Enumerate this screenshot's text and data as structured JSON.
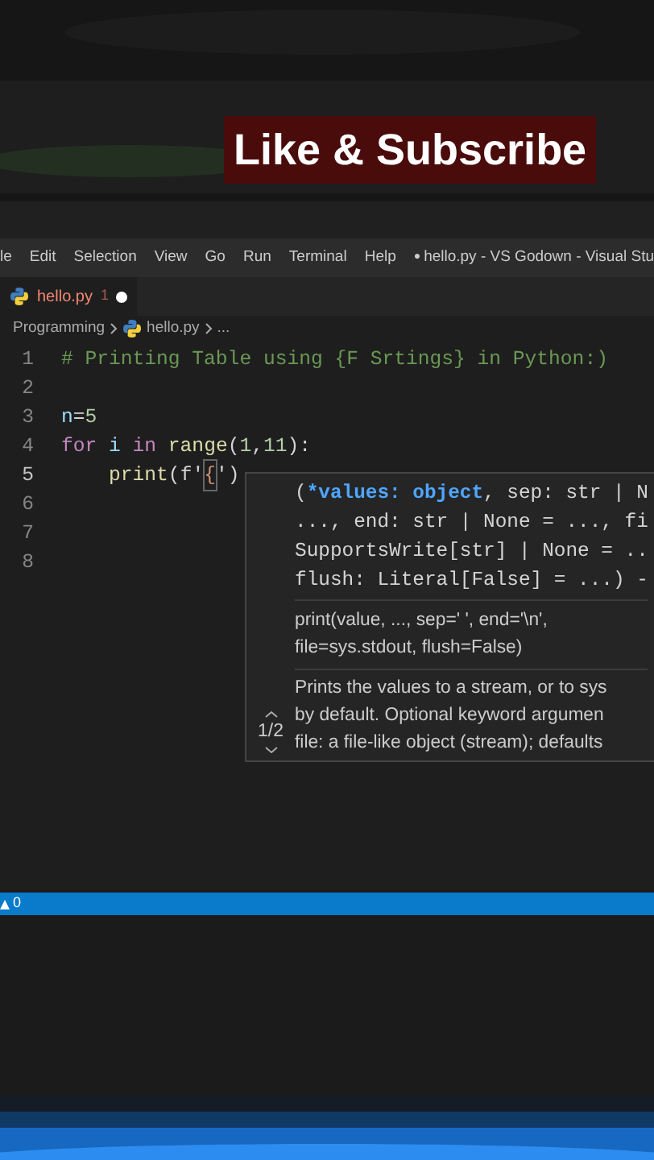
{
  "banner": {
    "text": "Like & Subscribe"
  },
  "menu_bar": {
    "items": [
      "le",
      "Edit",
      "Selection",
      "View",
      "Go",
      "Run",
      "Terminal",
      "Help"
    ],
    "title_dot": "●",
    "title": "hello.py - VS Godown - Visual Stu"
  },
  "tabs": [
    {
      "label": "hello.py",
      "problems": "1",
      "modified": true,
      "selected": true
    }
  ],
  "breadcrumb": [
    "Programming",
    "hello.py",
    "..."
  ],
  "code_lines": [
    {
      "number": "1",
      "current": false,
      "tokens": [
        {
          "text": "# Printing Table using {F Srtings} in Python:)",
          "kind": "comment"
        }
      ]
    },
    {
      "number": "2",
      "current": false
    },
    {
      "number": "3",
      "current": false,
      "tokens": [
        {
          "text": "n",
          "kind": "variable"
        },
        {
          "text": "=",
          "kind": "plain"
        },
        {
          "text": "5",
          "kind": "number"
        }
      ]
    },
    {
      "number": "4",
      "current": false,
      "tokens": [
        {
          "text": "for",
          "kind": "keyword"
        },
        {
          "text": " i ",
          "kind": "variable"
        },
        {
          "text": "in",
          "kind": "keyword"
        },
        {
          "text": " range",
          "kind": "function"
        },
        {
          "text": "(",
          "kind": "plain"
        },
        {
          "text": "1",
          "kind": "number"
        },
        {
          "text": ",",
          "kind": "plain"
        },
        {
          "text": "11",
          "kind": "number"
        },
        {
          "text": "):",
          "kind": "plain"
        }
      ]
    },
    {
      "number": "5",
      "current": true,
      "tokens": [
        {
          "text": "    print",
          "kind": "function"
        },
        {
          "text": "(",
          "kind": "plain"
        },
        {
          "text": "f'",
          "kind": "plain"
        },
        {
          "text": "{",
          "kind": "brace"
        },
        {
          "text": "')",
          "kind": "plain"
        }
      ]
    },
    {
      "number": "6",
      "current": false
    },
    {
      "number": "7",
      "current": false
    },
    {
      "number": "8",
      "current": false
    }
  ],
  "hover": {
    "signature": [
      [
        {
          "text": "(",
          "kind": "plain"
        },
        {
          "text": "*values: object",
          "kind": "active"
        },
        {
          "text": ", sep: str | N",
          "kind": "plain"
        }
      ],
      [
        {
          "text": "..., end: str | None = ..., fi",
          "kind": "plain"
        }
      ],
      [
        {
          "text": "SupportsWrite[str] | None = ..",
          "kind": "plain"
        }
      ],
      [
        {
          "text": "flush: Literal[False] = ...) -",
          "kind": "plain"
        }
      ]
    ],
    "usage": [
      "print(value, ..., sep=' ', end='\\n',",
      "file=sys.stdout, flush=False)"
    ],
    "description": [
      "Prints the values to a stream, or to sys",
      "by default. Optional keyword argumen",
      "file: a file-like object (stream); defaults"
    ],
    "overload": "1/2"
  },
  "status_bar": {
    "warnings": "0"
  }
}
